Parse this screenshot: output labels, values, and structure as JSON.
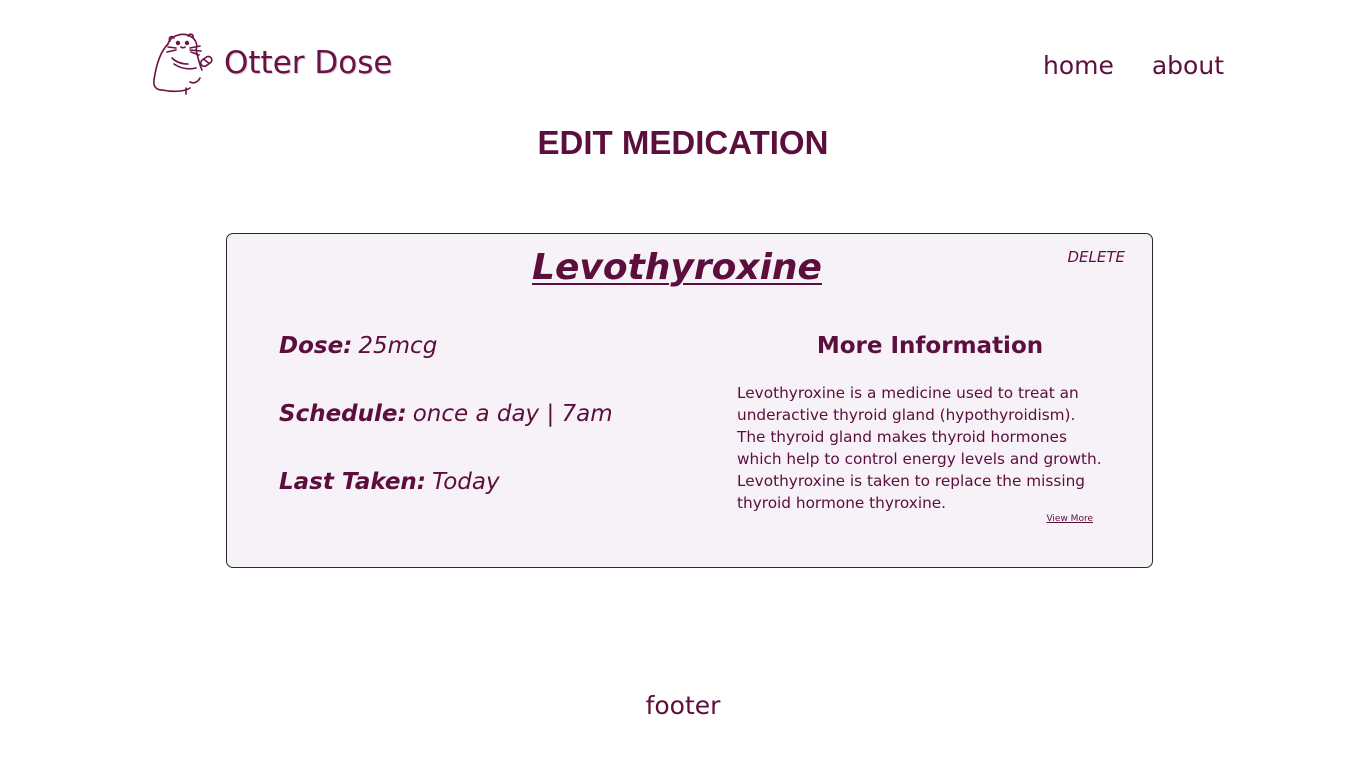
{
  "header": {
    "brand": "Otter Dose",
    "logo_icon": "otter-with-pill-icon",
    "nav": {
      "home": "home",
      "about": "about"
    }
  },
  "page_title": "EDIT MEDICATION",
  "medication": {
    "name": "Levothyroxine",
    "delete_label": "DELETE",
    "dose_label": "Dose:",
    "dose_value": "25mcg",
    "schedule_label": "Schedule:",
    "schedule_value": "once a day | 7am",
    "last_taken_label": "Last Taken:",
    "last_taken_value": "Today",
    "info_heading": "More Information",
    "info_text": "Levothyroxine is a medicine used to treat an underactive thyroid gland (hypothyroidism). The thyroid gland makes thyroid hormones which help to control energy levels and growth. Levothyroxine is taken to replace the missing thyroid hormone thyroxine.",
    "view_more_label": "View More"
  },
  "footer": {
    "text": "footer"
  },
  "colors": {
    "primary": "#5c0f3c",
    "card_background": "#f7f1f8",
    "card_border": "#2a2a2a",
    "page_background": "#ffffff"
  }
}
